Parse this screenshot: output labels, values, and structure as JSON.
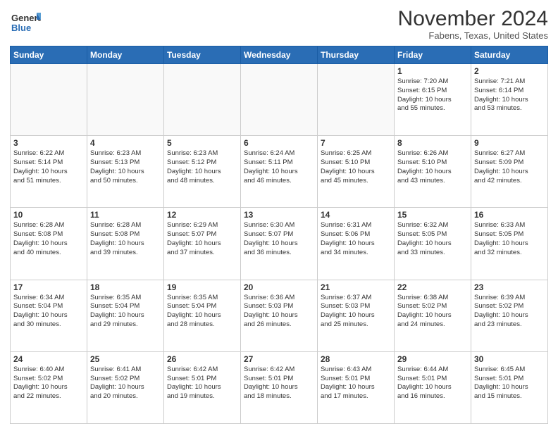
{
  "logo": {
    "general": "General",
    "blue": "Blue"
  },
  "header": {
    "month": "November 2024",
    "location": "Fabens, Texas, United States"
  },
  "days": [
    "Sunday",
    "Monday",
    "Tuesday",
    "Wednesday",
    "Thursday",
    "Friday",
    "Saturday"
  ],
  "weeks": [
    [
      {
        "day": "",
        "info": ""
      },
      {
        "day": "",
        "info": ""
      },
      {
        "day": "",
        "info": ""
      },
      {
        "day": "",
        "info": ""
      },
      {
        "day": "",
        "info": ""
      },
      {
        "day": "1",
        "info": "Sunrise: 7:20 AM\nSunset: 6:15 PM\nDaylight: 10 hours\nand 55 minutes."
      },
      {
        "day": "2",
        "info": "Sunrise: 7:21 AM\nSunset: 6:14 PM\nDaylight: 10 hours\nand 53 minutes."
      }
    ],
    [
      {
        "day": "3",
        "info": "Sunrise: 6:22 AM\nSunset: 5:14 PM\nDaylight: 10 hours\nand 51 minutes."
      },
      {
        "day": "4",
        "info": "Sunrise: 6:23 AM\nSunset: 5:13 PM\nDaylight: 10 hours\nand 50 minutes."
      },
      {
        "day": "5",
        "info": "Sunrise: 6:23 AM\nSunset: 5:12 PM\nDaylight: 10 hours\nand 48 minutes."
      },
      {
        "day": "6",
        "info": "Sunrise: 6:24 AM\nSunset: 5:11 PM\nDaylight: 10 hours\nand 46 minutes."
      },
      {
        "day": "7",
        "info": "Sunrise: 6:25 AM\nSunset: 5:10 PM\nDaylight: 10 hours\nand 45 minutes."
      },
      {
        "day": "8",
        "info": "Sunrise: 6:26 AM\nSunset: 5:10 PM\nDaylight: 10 hours\nand 43 minutes."
      },
      {
        "day": "9",
        "info": "Sunrise: 6:27 AM\nSunset: 5:09 PM\nDaylight: 10 hours\nand 42 minutes."
      }
    ],
    [
      {
        "day": "10",
        "info": "Sunrise: 6:28 AM\nSunset: 5:08 PM\nDaylight: 10 hours\nand 40 minutes."
      },
      {
        "day": "11",
        "info": "Sunrise: 6:28 AM\nSunset: 5:08 PM\nDaylight: 10 hours\nand 39 minutes."
      },
      {
        "day": "12",
        "info": "Sunrise: 6:29 AM\nSunset: 5:07 PM\nDaylight: 10 hours\nand 37 minutes."
      },
      {
        "day": "13",
        "info": "Sunrise: 6:30 AM\nSunset: 5:07 PM\nDaylight: 10 hours\nand 36 minutes."
      },
      {
        "day": "14",
        "info": "Sunrise: 6:31 AM\nSunset: 5:06 PM\nDaylight: 10 hours\nand 34 minutes."
      },
      {
        "day": "15",
        "info": "Sunrise: 6:32 AM\nSunset: 5:05 PM\nDaylight: 10 hours\nand 33 minutes."
      },
      {
        "day": "16",
        "info": "Sunrise: 6:33 AM\nSunset: 5:05 PM\nDaylight: 10 hours\nand 32 minutes."
      }
    ],
    [
      {
        "day": "17",
        "info": "Sunrise: 6:34 AM\nSunset: 5:04 PM\nDaylight: 10 hours\nand 30 minutes."
      },
      {
        "day": "18",
        "info": "Sunrise: 6:35 AM\nSunset: 5:04 PM\nDaylight: 10 hours\nand 29 minutes."
      },
      {
        "day": "19",
        "info": "Sunrise: 6:35 AM\nSunset: 5:04 PM\nDaylight: 10 hours\nand 28 minutes."
      },
      {
        "day": "20",
        "info": "Sunrise: 6:36 AM\nSunset: 5:03 PM\nDaylight: 10 hours\nand 26 minutes."
      },
      {
        "day": "21",
        "info": "Sunrise: 6:37 AM\nSunset: 5:03 PM\nDaylight: 10 hours\nand 25 minutes."
      },
      {
        "day": "22",
        "info": "Sunrise: 6:38 AM\nSunset: 5:02 PM\nDaylight: 10 hours\nand 24 minutes."
      },
      {
        "day": "23",
        "info": "Sunrise: 6:39 AM\nSunset: 5:02 PM\nDaylight: 10 hours\nand 23 minutes."
      }
    ],
    [
      {
        "day": "24",
        "info": "Sunrise: 6:40 AM\nSunset: 5:02 PM\nDaylight: 10 hours\nand 22 minutes."
      },
      {
        "day": "25",
        "info": "Sunrise: 6:41 AM\nSunset: 5:02 PM\nDaylight: 10 hours\nand 20 minutes."
      },
      {
        "day": "26",
        "info": "Sunrise: 6:42 AM\nSunset: 5:01 PM\nDaylight: 10 hours\nand 19 minutes."
      },
      {
        "day": "27",
        "info": "Sunrise: 6:42 AM\nSunset: 5:01 PM\nDaylight: 10 hours\nand 18 minutes."
      },
      {
        "day": "28",
        "info": "Sunrise: 6:43 AM\nSunset: 5:01 PM\nDaylight: 10 hours\nand 17 minutes."
      },
      {
        "day": "29",
        "info": "Sunrise: 6:44 AM\nSunset: 5:01 PM\nDaylight: 10 hours\nand 16 minutes."
      },
      {
        "day": "30",
        "info": "Sunrise: 6:45 AM\nSunset: 5:01 PM\nDaylight: 10 hours\nand 15 minutes."
      }
    ]
  ]
}
